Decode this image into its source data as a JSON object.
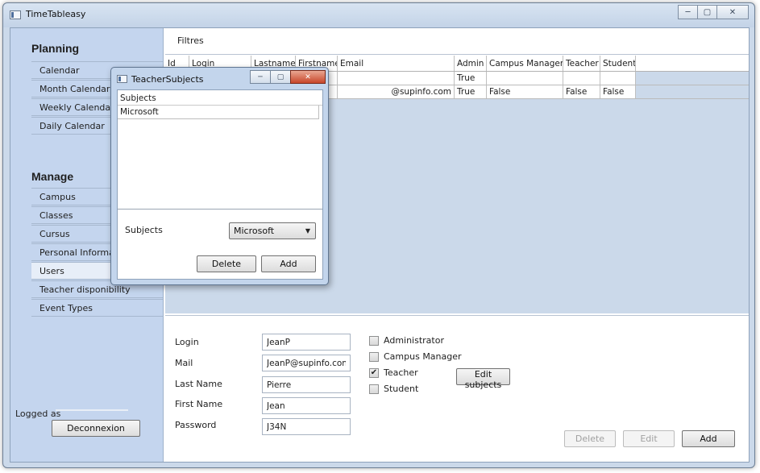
{
  "window": {
    "title": "TimeTableasy"
  },
  "sidebar": {
    "planning_title": "Planning",
    "planning_items": [
      "Calendar",
      "Month Calendar",
      "Weekly Calendar",
      "Daily Calendar"
    ],
    "manage_title": "Manage",
    "manage_items": [
      "Campus",
      "Classes",
      "Cursus",
      "Personal Informati",
      "Users",
      "Teacher disponibility",
      "Event Types"
    ],
    "selected_item": "Users",
    "logged_label": "Logged as",
    "deconnexion_label": "Deconnexion"
  },
  "filters": {
    "label": "Filtres"
  },
  "grid": {
    "columns": [
      "Id",
      "Login",
      "Lastname",
      "Firstname",
      "Email",
      "Admin",
      "Campus Manager",
      "Teacher",
      "Student"
    ],
    "rows": [
      [
        "",
        "",
        "",
        "",
        "",
        "True",
        "",
        "",
        ""
      ],
      [
        "",
        "",
        "",
        "",
        "@supinfo.com",
        "True",
        "False",
        "False",
        "False"
      ]
    ]
  },
  "form": {
    "login_label": "Login",
    "login_value": "JeanP",
    "mail_label": "Mail",
    "mail_value": "JeanP@supinfo.com",
    "lastname_label": "Last Name",
    "lastname_value": "Pierre",
    "firstname_label": "First Name",
    "firstname_value": "Jean",
    "password_label": "Password",
    "password_value": "J34N",
    "administrator_label": "Administrator",
    "administrator_checked": false,
    "campus_manager_label": "Campus Manager",
    "campus_manager_checked": false,
    "teacher_label": "Teacher",
    "teacher_checked": true,
    "student_label": "Student",
    "student_checked": false,
    "edit_subjects_label": "Edit subjects",
    "delete_label": "Delete",
    "edit_label": "Edit",
    "add_label": "Add"
  },
  "dialog": {
    "title": "TeacherSubjects",
    "list_header": "Subjects",
    "list_items": [
      "Microsoft"
    ],
    "subjects_label": "Subjects",
    "selected_subject": "Microsoft",
    "delete_label": "Delete",
    "add_label": "Add"
  }
}
